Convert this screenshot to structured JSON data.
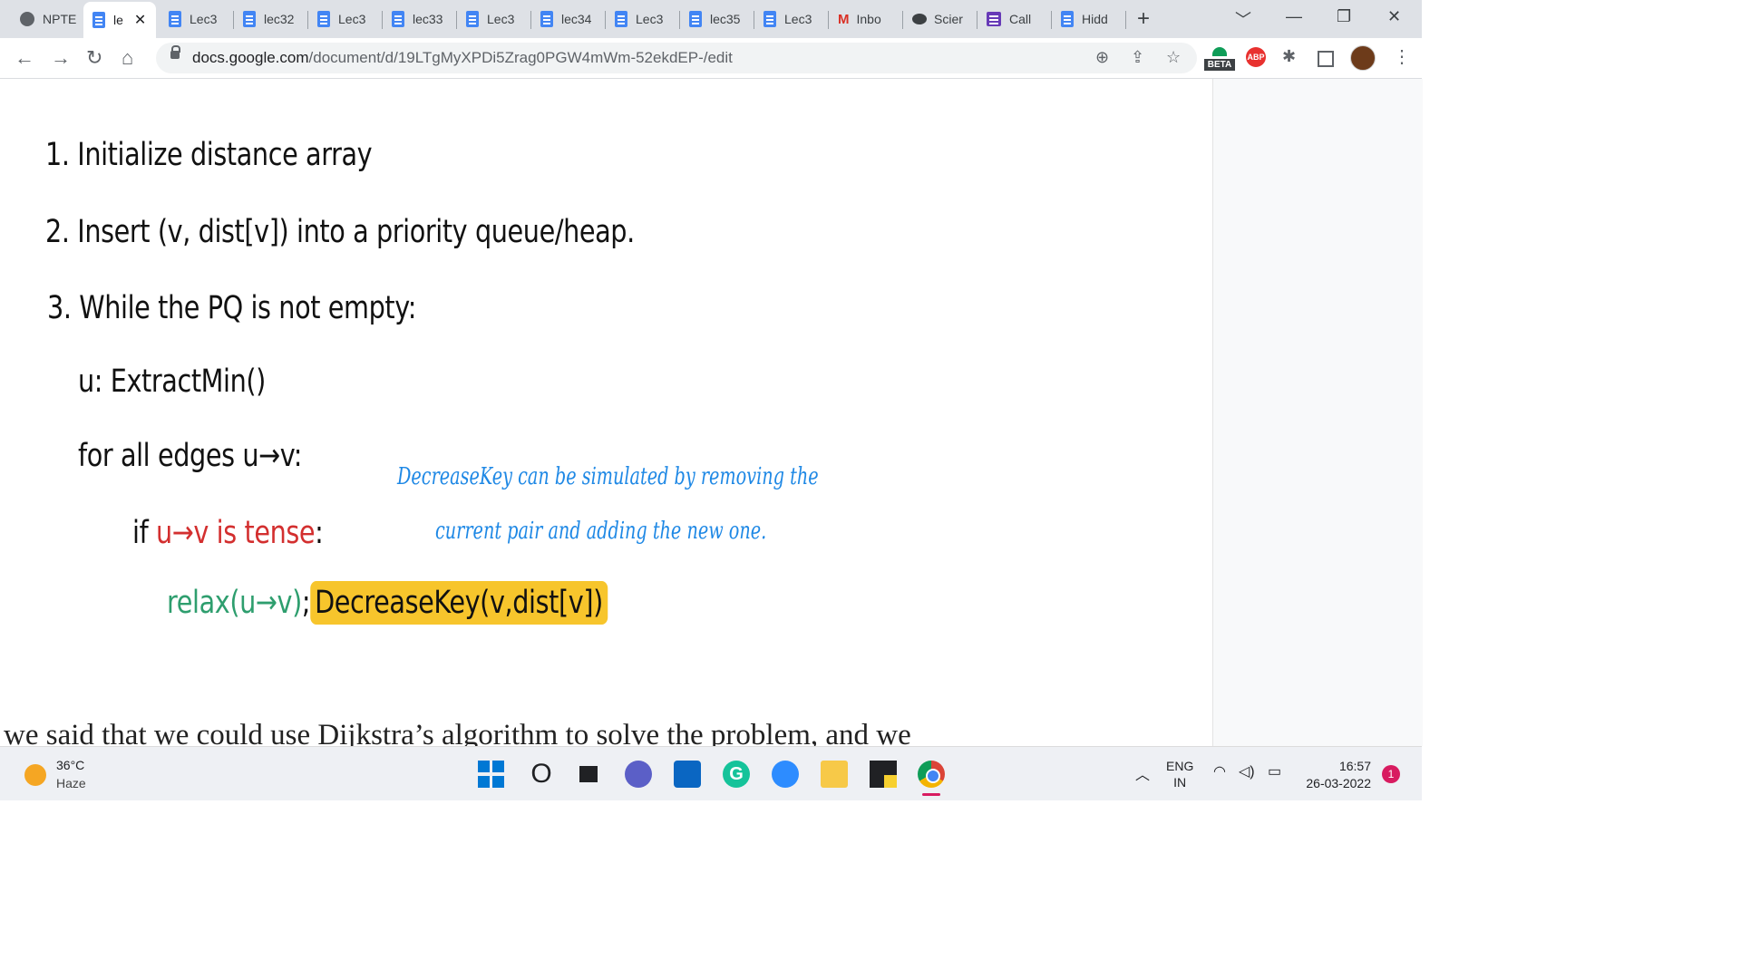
{
  "browser": {
    "tabs": [
      {
        "label": "NPTE",
        "icon": "globe-icon"
      },
      {
        "label": "le",
        "icon": "docs-icon",
        "active": true
      },
      {
        "label": "Lec3",
        "icon": "docs-icon"
      },
      {
        "label": "lec32",
        "icon": "docs-icon"
      },
      {
        "label": "Lec3",
        "icon": "docs-icon"
      },
      {
        "label": "lec33",
        "icon": "docs-icon"
      },
      {
        "label": "Lec3",
        "icon": "docs-icon"
      },
      {
        "label": "lec34",
        "icon": "docs-icon"
      },
      {
        "label": "Lec3",
        "icon": "docs-icon"
      },
      {
        "label": "lec35",
        "icon": "docs-icon"
      },
      {
        "label": "Lec3",
        "icon": "docs-icon"
      },
      {
        "label": "Inbo",
        "icon": "gmail-icon"
      },
      {
        "label": "Scier",
        "icon": "science-icon"
      },
      {
        "label": "Call",
        "icon": "forms-icon"
      },
      {
        "label": "Hidd",
        "icon": "docs-icon"
      }
    ],
    "close_glyph": "✕",
    "new_tab_glyph": "+",
    "url_domain": "docs.google.com",
    "url_path": "/document/d/19LTgMyXPDi5Zrag0PGW4mWm-52ekdEP-/edit",
    "beta_label": "BETA",
    "abp_label": "ABP"
  },
  "slide": {
    "steps": [
      "1. Initialize distance array",
      "2. Insert (v, dist[v]) into a priority queue/heap.",
      "3. While the PQ is not empty:"
    ],
    "extract": "u: ExtractMin()",
    "for_edges": "for all edges u→v:",
    "if_prefix": "if ",
    "if_condition": "u→v is tense",
    "if_suffix": ":",
    "relax": "relax(u→v)",
    "semicolon": ";",
    "decrease_key": "DecreaseKey(v,dist[v])",
    "note_line1": "DecreaseKey can be simulated by removing the",
    "note_line2": "current pair and adding the new one."
  },
  "doc_text": "we said that we could use Dijkstra’s algorithm to solve the problem, and we",
  "taskbar": {
    "temperature": "36°C",
    "weather": "Haze",
    "lang_top": "ENG",
    "lang_bottom": "IN",
    "time": "16:57",
    "date": "26-03-2022",
    "notifications": "1"
  },
  "colors": {
    "tense_red": "#d32f2f",
    "relax_green": "#2e9e6e",
    "highlight_yellow": "#f7c52c",
    "note_blue": "#1e88e5"
  }
}
